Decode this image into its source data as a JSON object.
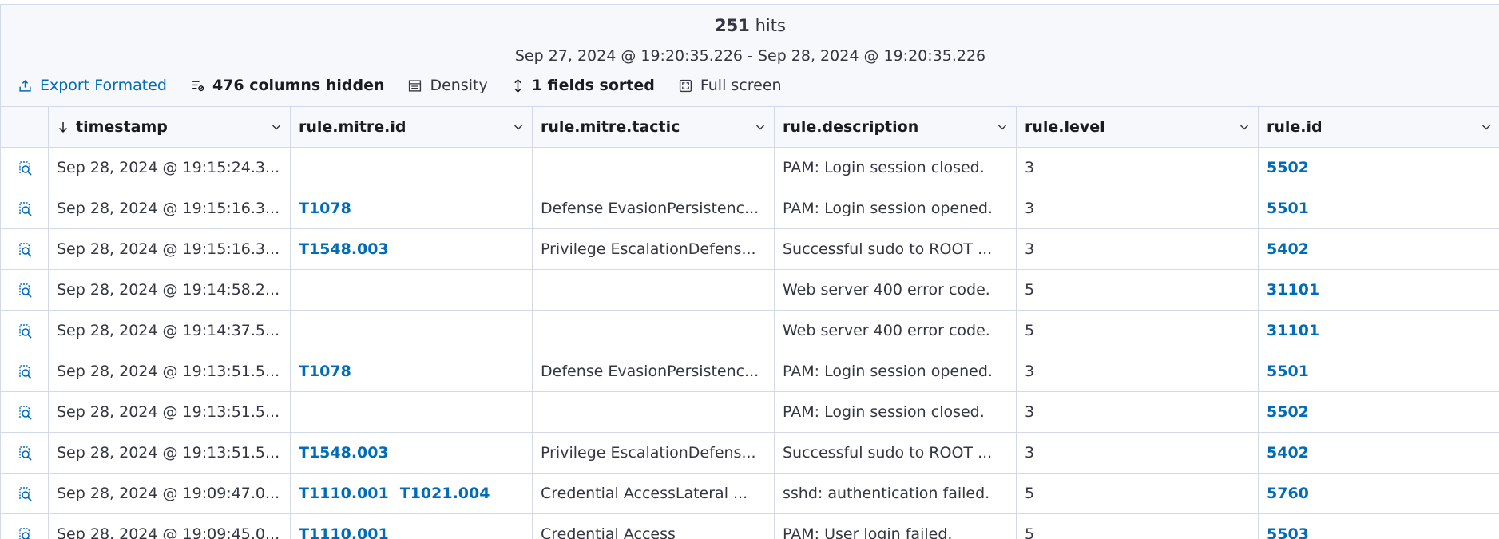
{
  "header": {
    "hits_count": "251",
    "hits_label": "hits",
    "time_range": "Sep 27, 2024 @ 19:20:35.226 - Sep 28, 2024 @ 19:20:35.226"
  },
  "toolbar": {
    "export_label": "Export Formated",
    "columns_hidden_label": "476 columns hidden",
    "density_label": "Density",
    "sorted_label": "1 fields sorted",
    "fullscreen_label": "Full screen"
  },
  "columns": [
    "timestamp",
    "rule.mitre.id",
    "rule.mitre.tactic",
    "rule.description",
    "rule.level",
    "rule.id"
  ],
  "rows": [
    {
      "timestamp": "Sep 28, 2024 @ 19:15:24.3...",
      "mitre_ids": [],
      "tactic": "",
      "description": "PAM: Login session closed.",
      "level": "3",
      "rule_id": "5502"
    },
    {
      "timestamp": "Sep 28, 2024 @ 19:15:16.3...",
      "mitre_ids": [
        "T1078"
      ],
      "tactic": "Defense EvasionPersistenc...",
      "description": "PAM: Login session opened.",
      "level": "3",
      "rule_id": "5501"
    },
    {
      "timestamp": "Sep 28, 2024 @ 19:15:16.3...",
      "mitre_ids": [
        "T1548.003"
      ],
      "tactic": "Privilege EscalationDefens...",
      "description": "Successful sudo to ROOT ...",
      "level": "3",
      "rule_id": "5402"
    },
    {
      "timestamp": "Sep 28, 2024 @ 19:14:58.2...",
      "mitre_ids": [],
      "tactic": "",
      "description": "Web server 400 error code.",
      "level": "5",
      "rule_id": "31101"
    },
    {
      "timestamp": "Sep 28, 2024 @ 19:14:37.5...",
      "mitre_ids": [],
      "tactic": "",
      "description": "Web server 400 error code.",
      "level": "5",
      "rule_id": "31101"
    },
    {
      "timestamp": "Sep 28, 2024 @ 19:13:51.5...",
      "mitre_ids": [
        "T1078"
      ],
      "tactic": "Defense EvasionPersistenc...",
      "description": "PAM: Login session opened.",
      "level": "3",
      "rule_id": "5501"
    },
    {
      "timestamp": "Sep 28, 2024 @ 19:13:51.5...",
      "mitre_ids": [],
      "tactic": "",
      "description": "PAM: Login session closed.",
      "level": "3",
      "rule_id": "5502"
    },
    {
      "timestamp": "Sep 28, 2024 @ 19:13:51.5...",
      "mitre_ids": [
        "T1548.003"
      ],
      "tactic": "Privilege EscalationDefens...",
      "description": "Successful sudo to ROOT ...",
      "level": "3",
      "rule_id": "5402"
    },
    {
      "timestamp": "Sep 28, 2024 @ 19:09:47.0...",
      "mitre_ids": [
        "T1110.001",
        "T1021.004"
      ],
      "tactic": "Credential AccessLateral ...",
      "description": "sshd: authentication failed.",
      "level": "5",
      "rule_id": "5760"
    },
    {
      "timestamp": "Sep 28, 2024 @ 19:09:45.0...",
      "mitre_ids": [
        "T1110.001"
      ],
      "tactic": "Credential Access",
      "description": "PAM: User login failed.",
      "level": "5",
      "rule_id": "5503"
    }
  ],
  "icons": {
    "export": "share-icon",
    "columns": "columns-icon",
    "density": "table-density-icon",
    "sort": "sort-icon",
    "fullscreen": "fullscreen-icon",
    "inspect": "inspect-document-icon",
    "sort_direction": "arrow-down-icon",
    "column_menu": "chevron-down-icon"
  },
  "colors": {
    "link": "#006bb8",
    "text": "#343741",
    "border": "#d3dae6",
    "header_bg": "#f7f8fc"
  }
}
